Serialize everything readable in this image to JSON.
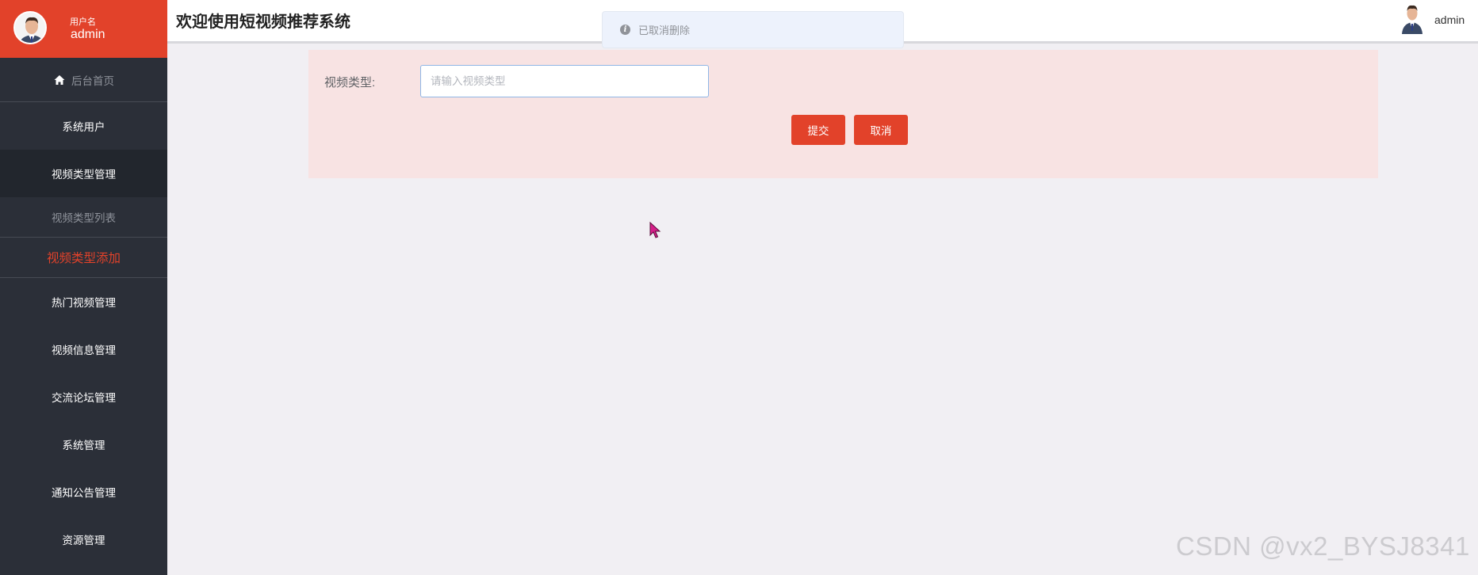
{
  "sidebar": {
    "user_role": "用户名",
    "user_name": "admin",
    "home_label": "后台首页",
    "menu": {
      "system_users": "系统用户",
      "video_type_mgmt": "视频类型管理",
      "video_type_list": "视频类型列表",
      "video_type_add": "视频类型添加",
      "hot_video_mgmt": "热门视频管理",
      "video_info_mgmt": "视频信息管理",
      "forum_mgmt": "交流论坛管理",
      "system_mgmt": "系统管理",
      "notice_mgmt": "通知公告管理",
      "resource_mgmt": "资源管理"
    }
  },
  "header": {
    "title": "欢迎使用短视频推荐系统",
    "user_name": "admin"
  },
  "toast": {
    "icon": "info-icon",
    "icon_char": "i",
    "text": "已取消删除"
  },
  "form": {
    "label": "视频类型:",
    "input_placeholder": "请输入视频类型",
    "input_value": "",
    "submit_label": "提交",
    "cancel_label": "取消"
  },
  "watermark": "CSDN @vx2_BYSJ8341",
  "colors": {
    "accent": "#e2422a",
    "sidebar_bg": "#2b2f38",
    "form_bg": "#f8e3e3",
    "page_bg": "#f1eff3"
  }
}
